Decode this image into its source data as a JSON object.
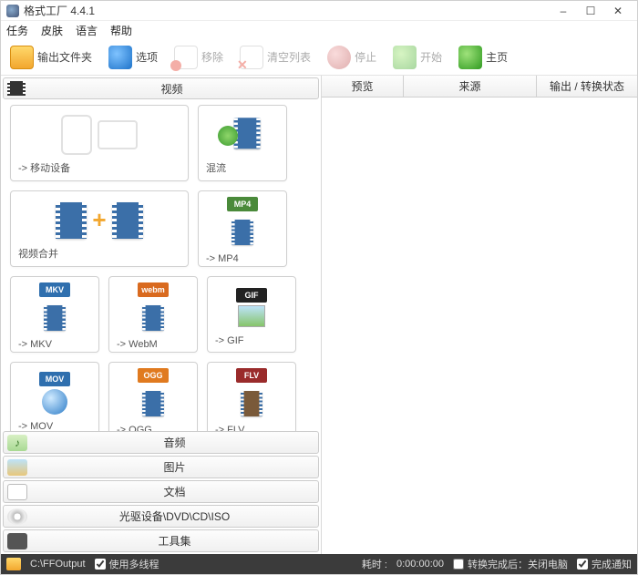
{
  "window": {
    "title": "格式工厂 4.4.1",
    "minimize": "–",
    "maximize": "☐",
    "close": "✕"
  },
  "menu": {
    "task": "任务",
    "skin": "皮肤",
    "language": "语言",
    "help": "帮助"
  },
  "toolbar": {
    "output_folder": "输出文件夹",
    "options": "选项",
    "remove": "移除",
    "clear_list": "清空列表",
    "stop": "停止",
    "start": "开始",
    "home": "主页"
  },
  "categories": {
    "video": "视频",
    "audio": "音频",
    "image": "图片",
    "document": "文档",
    "disc": "光驱设备\\DVD\\CD\\ISO",
    "toolkit": "工具集"
  },
  "video_tiles": {
    "mobile": "-> 移动设备",
    "mux": "混流",
    "join": "视频合并",
    "mp4": "-> MP4",
    "mkv": "-> MKV",
    "webm": "-> WebM",
    "gif": "-> GIF",
    "mov": "-> MOV",
    "ogg": "-> OGG",
    "flv": "-> FLV"
  },
  "badges": {
    "mp4": "MP4",
    "mkv": "MKV",
    "webm": "webm",
    "gif": "GIF",
    "mov": "MOV",
    "ogg": "OGG",
    "flv": "FLV"
  },
  "right_columns": {
    "preview": "预览",
    "source": "来源",
    "output_status": "输出 / 转换状态"
  },
  "status": {
    "output_path": "C:\\FFOutput",
    "multithread": "使用多线程",
    "elapsed_label": "耗时 :",
    "elapsed_value": "0:00:00:00",
    "shutdown": "转换完成后：关闭电脑",
    "notify": "完成通知"
  }
}
